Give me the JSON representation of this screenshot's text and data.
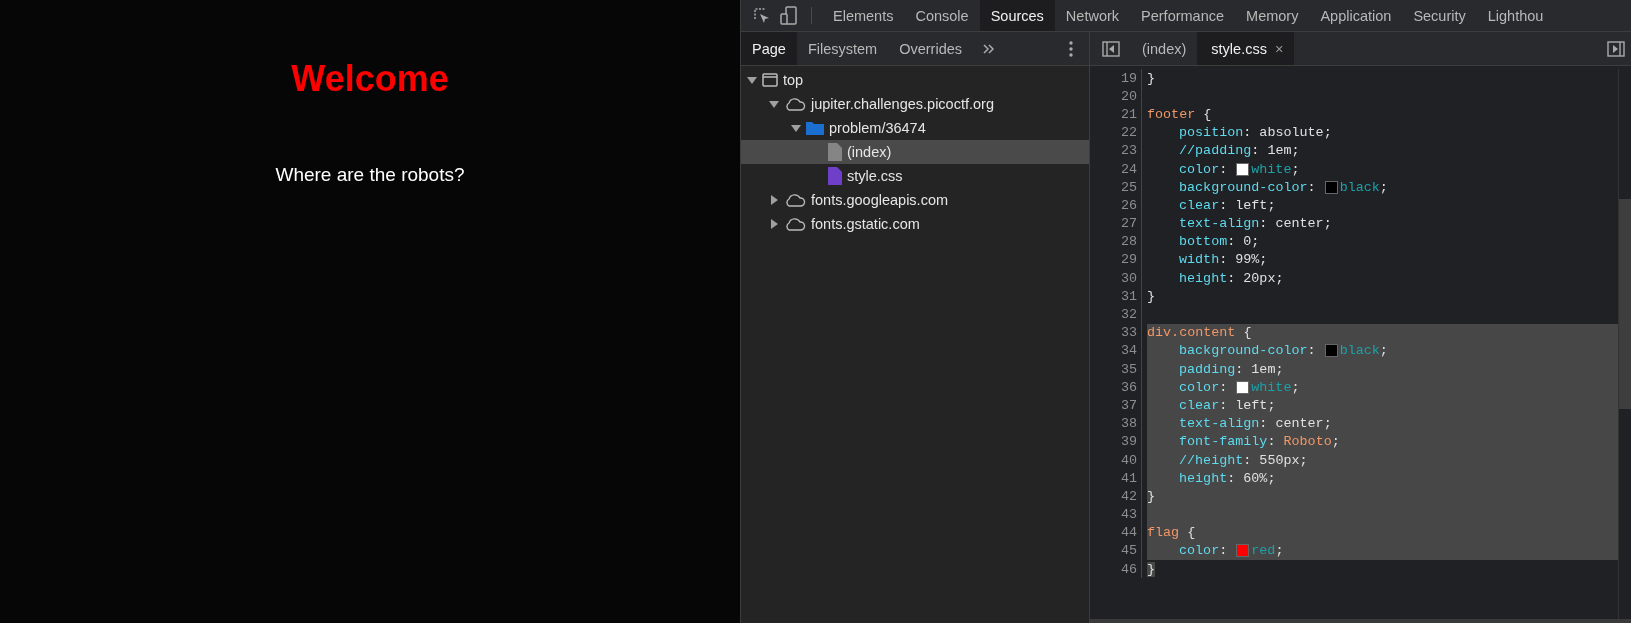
{
  "page": {
    "heading": "Welcome",
    "text": "Where are the robots?"
  },
  "devtools": {
    "panels": [
      {
        "label": "Elements",
        "selected": false
      },
      {
        "label": "Console",
        "selected": false
      },
      {
        "label": "Sources",
        "selected": true
      },
      {
        "label": "Network",
        "selected": false
      },
      {
        "label": "Performance",
        "selected": false
      },
      {
        "label": "Memory",
        "selected": false
      },
      {
        "label": "Application",
        "selected": false
      },
      {
        "label": "Security",
        "selected": false
      },
      {
        "label": "Lighthou",
        "selected": false
      }
    ],
    "navigator_tabs": [
      {
        "label": "Page",
        "selected": true
      },
      {
        "label": "Filesystem",
        "selected": false
      },
      {
        "label": "Overrides",
        "selected": false
      }
    ],
    "file_tree": [
      {
        "label": "top",
        "kind": "frame",
        "expanded": true,
        "selected": false,
        "children": [
          {
            "label": "jupiter.challenges.picoctf.org",
            "kind": "domain",
            "expanded": true,
            "selected": false,
            "children": [
              {
                "label": "problem/36474",
                "kind": "folder",
                "expanded": true,
                "selected": false,
                "children": [
                  {
                    "label": "(index)",
                    "kind": "document",
                    "selected": true
                  },
                  {
                    "label": "style.css",
                    "kind": "stylesheet",
                    "selected": false
                  }
                ]
              }
            ]
          },
          {
            "label": "fonts.googleapis.com",
            "kind": "domain",
            "expanded": false,
            "selected": false
          },
          {
            "label": "fonts.gstatic.com",
            "kind": "domain",
            "expanded": false,
            "selected": false
          }
        ]
      }
    ],
    "editor_tabs": [
      {
        "label": "(index)",
        "selected": false
      },
      {
        "label": "style.css",
        "selected": true,
        "close": "×"
      }
    ],
    "code_lines": [
      {
        "number": "19",
        "indented": false,
        "highlighted": false,
        "tokens": [
          {
            "kind": "punct",
            "text": "}"
          }
        ]
      },
      {
        "number": "20",
        "highlighted": false
      },
      {
        "number": "21",
        "indented": false,
        "highlighted": false,
        "tokens": [
          {
            "kind": "selector",
            "text": "footer"
          },
          {
            "kind": "punct",
            "text": " {"
          }
        ]
      },
      {
        "number": "22",
        "indented": true,
        "highlighted": false,
        "tokens": [
          {
            "kind": "property",
            "text": "position"
          },
          {
            "kind": "punct",
            "text": ": absolute;"
          }
        ]
      },
      {
        "number": "23",
        "indented": true,
        "highlighted": false,
        "tokens": [
          {
            "kind": "property",
            "text": "//padding"
          },
          {
            "kind": "punct",
            "text": ": 1em;"
          }
        ]
      },
      {
        "number": "24",
        "indented": true,
        "highlighted": false,
        "tokens": [
          {
            "kind": "property",
            "text": "color"
          },
          {
            "kind": "punct",
            "text": ": "
          },
          {
            "kind": "swatch",
            "color": "#ffffff"
          },
          {
            "kind": "keyword",
            "text": "white"
          },
          {
            "kind": "punct",
            "text": ";"
          }
        ]
      },
      {
        "number": "25",
        "indented": true,
        "highlighted": false,
        "tokens": [
          {
            "kind": "property",
            "text": "background-color"
          },
          {
            "kind": "punct",
            "text": ": "
          },
          {
            "kind": "swatch",
            "color": "#000000"
          },
          {
            "kind": "keyword",
            "text": "black"
          },
          {
            "kind": "punct",
            "text": ";"
          }
        ]
      },
      {
        "number": "26",
        "indented": true,
        "highlighted": false,
        "tokens": [
          {
            "kind": "property",
            "text": "clear"
          },
          {
            "kind": "punct",
            "text": ": left;"
          }
        ]
      },
      {
        "number": "27",
        "indented": true,
        "highlighted": false,
        "tokens": [
          {
            "kind": "property",
            "text": "text-align"
          },
          {
            "kind": "punct",
            "text": ": center;"
          }
        ]
      },
      {
        "number": "28",
        "indented": true,
        "highlighted": false,
        "tokens": [
          {
            "kind": "property",
            "text": "bottom"
          },
          {
            "kind": "punct",
            "text": ": 0;"
          }
        ]
      },
      {
        "number": "29",
        "indented": true,
        "highlighted": false,
        "tokens": [
          {
            "kind": "property",
            "text": "width"
          },
          {
            "kind": "punct",
            "text": ": 99%;"
          }
        ]
      },
      {
        "number": "30",
        "indented": true,
        "highlighted": false,
        "tokens": [
          {
            "kind": "property",
            "text": "height"
          },
          {
            "kind": "punct",
            "text": ": 20px;"
          }
        ]
      },
      {
        "number": "31",
        "indented": false,
        "highlighted": false,
        "tokens": [
          {
            "kind": "punct",
            "text": "}"
          }
        ]
      },
      {
        "number": "32",
        "highlighted": false
      },
      {
        "number": "33",
        "indented": false,
        "highlighted": true,
        "tokens": [
          {
            "kind": "selector",
            "text": "div.content"
          },
          {
            "kind": "punct",
            "text": " {"
          }
        ]
      },
      {
        "number": "34",
        "indented": true,
        "highlighted": true,
        "tokens": [
          {
            "kind": "property",
            "text": "background-color"
          },
          {
            "kind": "punct",
            "text": ": "
          },
          {
            "kind": "swatch",
            "color": "#000000"
          },
          {
            "kind": "keyword",
            "text": "black"
          },
          {
            "kind": "punct",
            "text": ";"
          }
        ]
      },
      {
        "number": "35",
        "indented": true,
        "highlighted": true,
        "tokens": [
          {
            "kind": "property",
            "text": "padding"
          },
          {
            "kind": "punct",
            "text": ": 1em;"
          }
        ]
      },
      {
        "number": "36",
        "indented": true,
        "highlighted": true,
        "tokens": [
          {
            "kind": "property",
            "text": "color"
          },
          {
            "kind": "punct",
            "text": ": "
          },
          {
            "kind": "swatch",
            "color": "#ffffff"
          },
          {
            "kind": "keyword",
            "text": "white"
          },
          {
            "kind": "punct",
            "text": ";"
          }
        ]
      },
      {
        "number": "37",
        "indented": true,
        "highlighted": true,
        "tokens": [
          {
            "kind": "property",
            "text": "clear"
          },
          {
            "kind": "punct",
            "text": ": left;"
          }
        ]
      },
      {
        "number": "38",
        "indented": true,
        "highlighted": true,
        "tokens": [
          {
            "kind": "property",
            "text": "text-align"
          },
          {
            "kind": "punct",
            "text": ": center;"
          }
        ]
      },
      {
        "number": "39",
        "indented": true,
        "highlighted": true,
        "tokens": [
          {
            "kind": "property",
            "text": "font-family"
          },
          {
            "kind": "punct",
            "text": ": "
          },
          {
            "kind": "string",
            "text": "Roboto"
          },
          {
            "kind": "punct",
            "text": ";"
          }
        ]
      },
      {
        "number": "40",
        "indented": true,
        "highlighted": true,
        "tokens": [
          {
            "kind": "property",
            "text": "//height"
          },
          {
            "kind": "punct",
            "text": ": 550px;"
          }
        ]
      },
      {
        "number": "41",
        "indented": true,
        "highlighted": true,
        "tokens": [
          {
            "kind": "property",
            "text": "height"
          },
          {
            "kind": "punct",
            "text": ": 60%;"
          }
        ]
      },
      {
        "number": "42",
        "indented": false,
        "highlighted": true,
        "tokens": [
          {
            "kind": "punct",
            "text": "}"
          }
        ]
      },
      {
        "number": "43",
        "highlighted": true
      },
      {
        "number": "44",
        "indented": false,
        "highlighted": true,
        "tokens": [
          {
            "kind": "selector",
            "text": "flag"
          },
          {
            "kind": "punct",
            "text": " {"
          }
        ]
      },
      {
        "number": "45",
        "indented": true,
        "highlighted": true,
        "tokens": [
          {
            "kind": "property",
            "text": "color"
          },
          {
            "kind": "punct",
            "text": ": "
          },
          {
            "kind": "swatch",
            "color": "#ff0000"
          },
          {
            "kind": "keyword",
            "text": "red"
          },
          {
            "kind": "punct",
            "text": ";"
          }
        ]
      },
      {
        "number": "46",
        "indented": false,
        "highlighted": false,
        "tokens": [
          {
            "kind": "cursor",
            "text": "}"
          }
        ]
      }
    ]
  }
}
